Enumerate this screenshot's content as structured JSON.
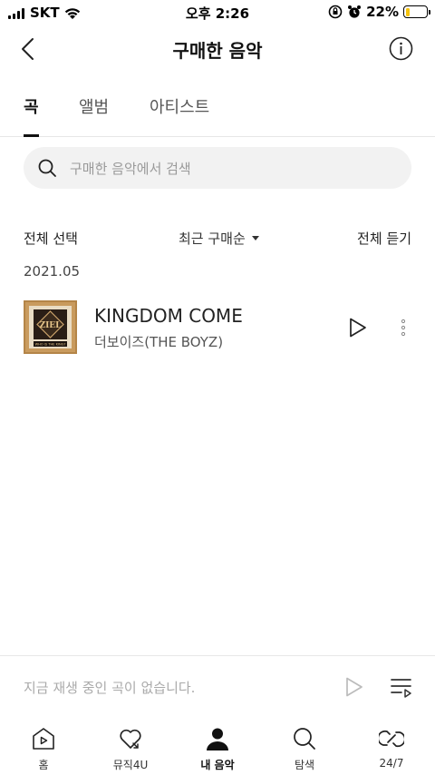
{
  "status_bar": {
    "carrier": "SKT",
    "time": "오후 2:26",
    "battery_percent": "22%",
    "battery_level": 0.22,
    "icons": [
      "signal-icon",
      "wifi-icon",
      "orientation-lock-icon",
      "alarm-icon",
      "battery-charging-icon"
    ]
  },
  "header": {
    "title": "구매한 음악",
    "back_icon": "chevron-left-icon",
    "info_icon": "info-icon"
  },
  "tabs": [
    {
      "label": "곡",
      "active": true
    },
    {
      "label": "앨범",
      "active": false
    },
    {
      "label": "아티스트",
      "active": false
    }
  ],
  "search": {
    "placeholder": "구매한 음악에서 검색"
  },
  "list_controls": {
    "select_all": "전체 선택",
    "sort": "최근 구매순",
    "play_all": "전체 듣기"
  },
  "groups": [
    {
      "date": "2021.05",
      "songs": [
        {
          "title": "KINGDOM COME",
          "artist": "더보이즈(THE BOYZ)",
          "album_art_text": "WHO IS THE KING?"
        }
      ]
    }
  ],
  "mini_player": {
    "text": "지금 재생 중인 곡이 없습니다."
  },
  "bottom_nav": [
    {
      "label": "홈",
      "icon": "home-play-icon",
      "active": false
    },
    {
      "label": "뮤직4U",
      "icon": "heart-icon",
      "active": false
    },
    {
      "label": "내 음악",
      "icon": "user-icon",
      "active": true
    },
    {
      "label": "탐색",
      "icon": "search-icon",
      "active": false
    },
    {
      "label": "24/7",
      "icon": "infinity-icon",
      "active": false
    }
  ],
  "colors": {
    "accent_text": "#111111",
    "muted_text": "#9a9a9a",
    "search_bg": "#f2f2f2",
    "battery_fill": "#f4c20d"
  }
}
